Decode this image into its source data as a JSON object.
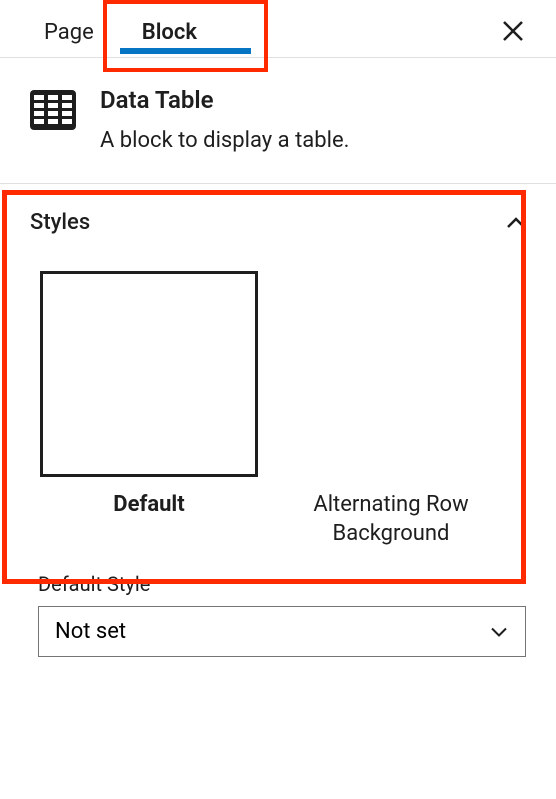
{
  "tabs": {
    "page": "Page",
    "block": "Block"
  },
  "block": {
    "title": "Data Table",
    "description": "A block to display a table."
  },
  "styles": {
    "heading": "Styles",
    "options": [
      {
        "label": "Default"
      },
      {
        "label": "Alternating Row Background"
      }
    ],
    "defaultStyleLabel": "Default Style",
    "defaultStyleValue": "Not set"
  }
}
